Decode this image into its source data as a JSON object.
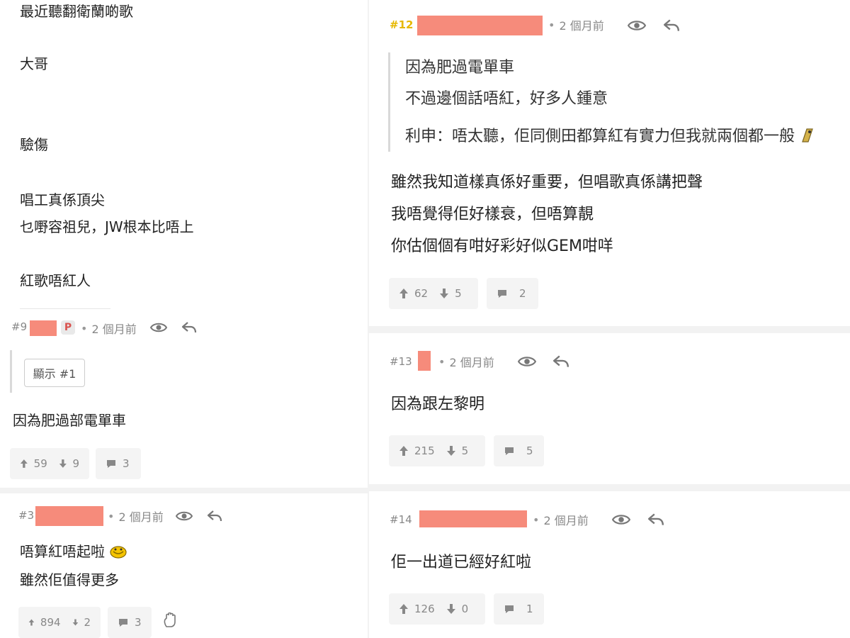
{
  "left_column": {
    "top_lines": [
      "最近聽翻衛蘭啲歌",
      "大哥",
      "驗傷",
      "唱工真係頂尖",
      "乜嘢容祖兒，JW根本比唔上",
      "紅歌唔紅人"
    ],
    "post9": {
      "number": "#9",
      "badge": "P",
      "dot": "•",
      "time": "2 個月前",
      "show_button": "顯示 #1",
      "content": [
        "因為肥過部電單車"
      ],
      "upvotes": "59",
      "downvotes": "9",
      "replies": "3"
    },
    "post3": {
      "number": "#3",
      "dot": "•",
      "time": "2 個月前",
      "content": [
        "唔算紅唔起啦",
        "雖然佢值得更多"
      ],
      "upvotes": "894",
      "downvotes": "2",
      "replies": "3"
    }
  },
  "right_column": {
    "post12": {
      "number": "#12",
      "dot": "•",
      "time": "2 個月前",
      "quote": [
        "因為肥過電單車",
        "不過邊個話唔紅，好多人鍾意",
        "利申：唔太聽，佢同側田都算紅有實力但我就兩個都一般"
      ],
      "content": [
        "雖然我知道樣真係好重要，但唱歌真係講把聲",
        "我唔覺得佢好樣衰，但唔算靚",
        "你估個個有咁好彩好似GEM咁咩"
      ],
      "upvotes": "62",
      "downvotes": "5",
      "replies": "2"
    },
    "post13": {
      "number": "#13",
      "dot": "•",
      "time": "2 個月前",
      "content": [
        "因為跟左黎明"
      ],
      "upvotes": "215",
      "downvotes": "5",
      "replies": "5"
    },
    "post14": {
      "number": "#14",
      "dot": "•",
      "time": "2 個月前",
      "content": [
        "佢一出道已經好紅啦"
      ],
      "upvotes": "126",
      "downvotes": "0",
      "replies": "1"
    }
  },
  "colors": {
    "redaction": "#f68b7b",
    "highlight_number": "#e6b800",
    "vote_bg": "#f4f4f4",
    "divider": "#f2f2f2"
  },
  "icons": [
    "eye-icon",
    "reply-icon",
    "thumb-up-arrow-icon",
    "thumb-down-arrow-icon",
    "comment-icon",
    "emoji-icon",
    "hand-icon"
  ]
}
